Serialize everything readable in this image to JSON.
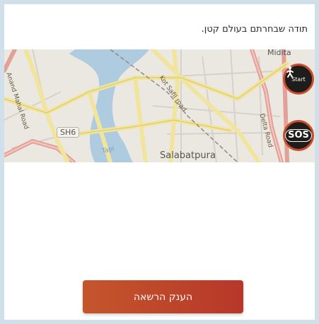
{
  "intro_text": "תודה שבחרתם בעולם קטן.",
  "map": {
    "labels": {
      "salabatpura": "Salabatpura",
      "sh6": "SH6",
      "anand_mahal_road": "Anand Mahal Road",
      "kot_safil_road": "Kot Safil road",
      "delta_road": "Delta Road",
      "top_right_fragment": "Midita",
      "river_fragment": "Tapi"
    },
    "start_button": {
      "label": "Start",
      "icon": "walking-person-icon"
    },
    "sos_button": {
      "label": "SOS",
      "icon": "sos-icon"
    }
  },
  "cta_label": "הענק הרשאה",
  "colors": {
    "accent": "#c4562b",
    "accent_dark": "#b7372a",
    "river": "#aecbe0",
    "road_major": "#f1e49d",
    "road_arterial": "#e2a098",
    "button_dark": "#1f1d1c"
  }
}
